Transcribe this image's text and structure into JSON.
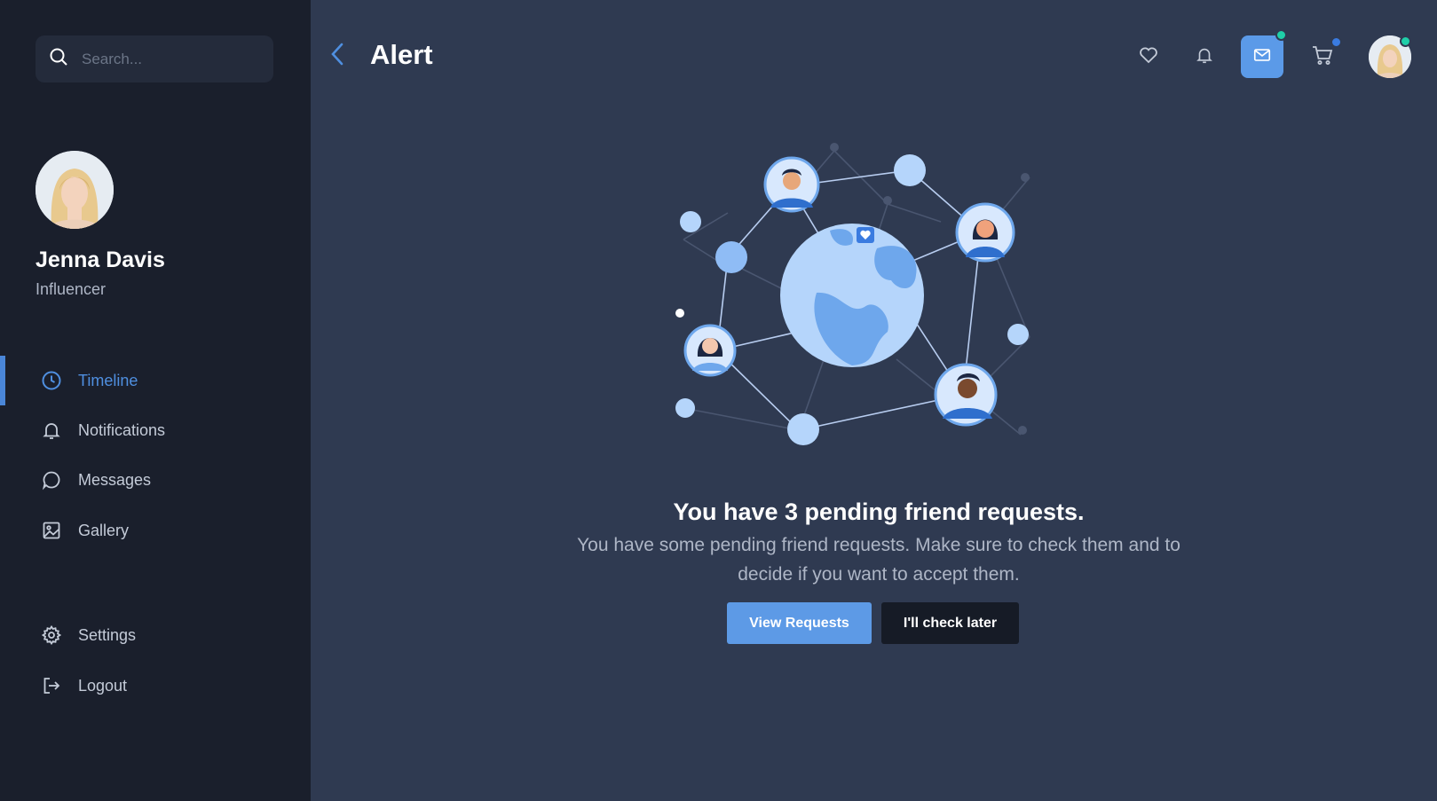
{
  "sidebar": {
    "search": {
      "placeholder": "Search..."
    },
    "profile": {
      "name": "Jenna Davis",
      "role": "Influencer"
    },
    "nav": [
      {
        "label": "Timeline",
        "icon": "clock-icon",
        "active": true
      },
      {
        "label": "Notifications",
        "icon": "bell-icon",
        "active": false
      },
      {
        "label": "Messages",
        "icon": "chat-bubble-icon",
        "active": false
      },
      {
        "label": "Gallery",
        "icon": "image-icon",
        "active": false
      }
    ],
    "bottom_nav": [
      {
        "label": "Settings",
        "icon": "gear-icon"
      },
      {
        "label": "Logout",
        "icon": "logout-icon"
      }
    ]
  },
  "header": {
    "title": "Alert",
    "icons": [
      "heart-icon",
      "bell-icon",
      "mail-icon",
      "cart-icon"
    ],
    "badges": {
      "mail": "#1fcfa8",
      "cart": "#3a7be0",
      "avatar": "#1fcfa8"
    }
  },
  "main": {
    "headline": "You have 3 pending friend requests.",
    "description": "You have some pending friend requests. Make sure to check them and to decide if you want to accept them.",
    "primary_button": "View Requests",
    "secondary_button": "I'll check later"
  },
  "colors": {
    "accent": "#5d9ae6",
    "sidebar_bg": "#1a1f2c",
    "main_bg": "#2f3a51",
    "active_nav": "#4f8fe0"
  }
}
